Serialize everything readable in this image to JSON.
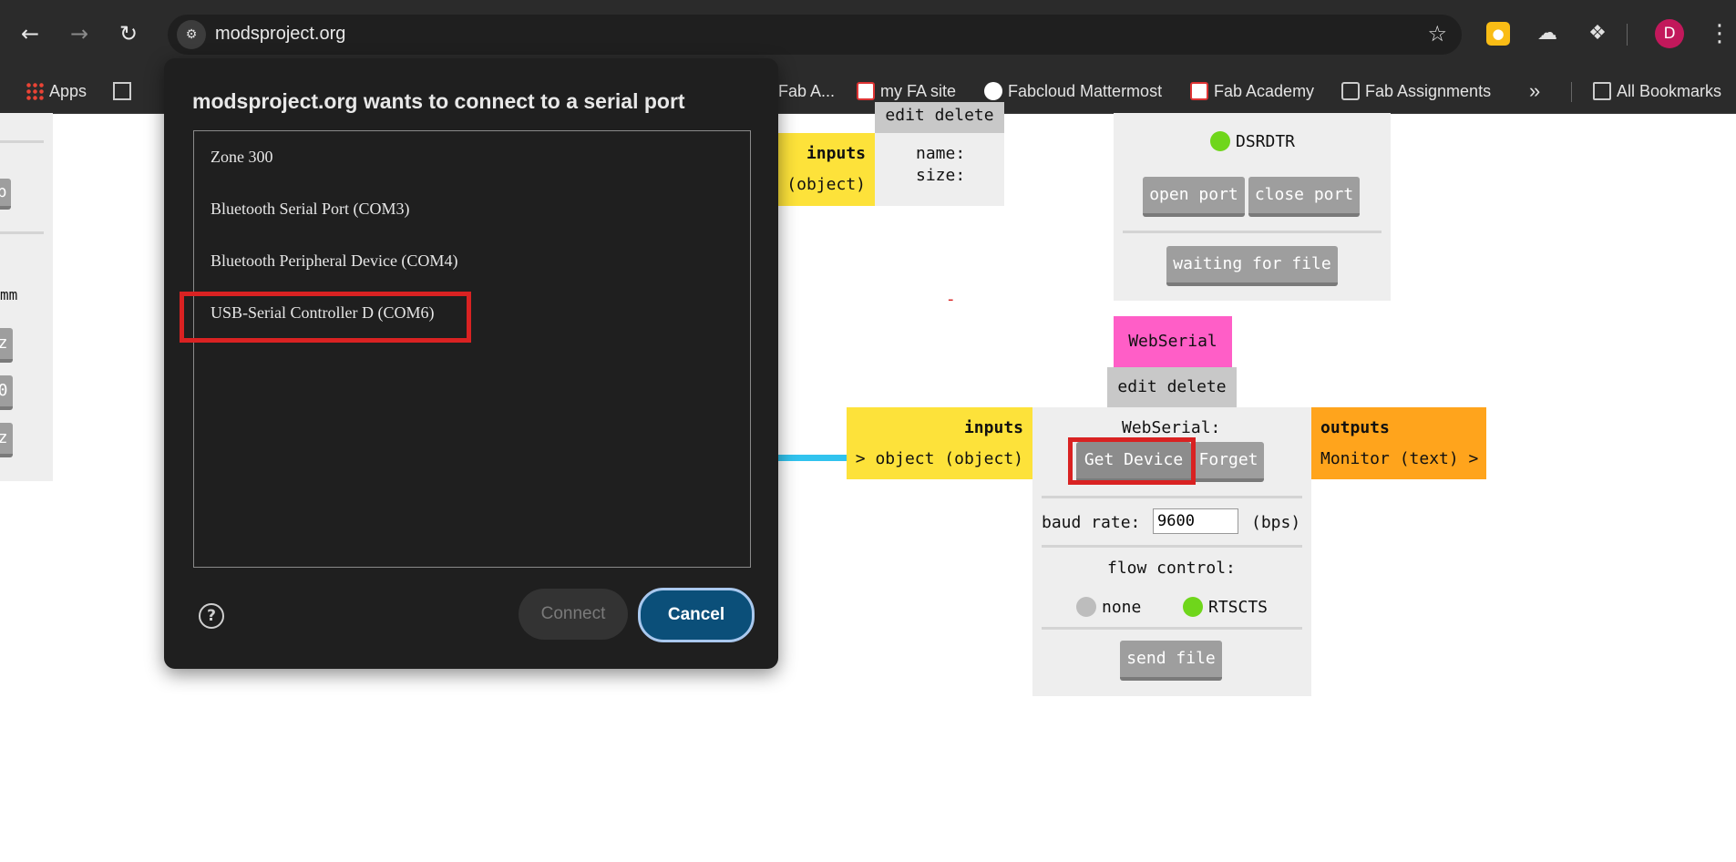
{
  "browser": {
    "url": "modsproject.org",
    "avatar_letter": "D",
    "bookmarks": [
      {
        "label": "Apps"
      },
      {
        "label": "Fab A..."
      },
      {
        "label": "my FA site"
      },
      {
        "label": "Fabcloud Mattermost"
      },
      {
        "label": "Fab Academy"
      },
      {
        "label": "Fab Assignments"
      }
    ],
    "all_bookmarks": "All Bookmarks",
    "overflow": "»"
  },
  "dialog": {
    "title": "modsproject.org wants to connect to a serial port",
    "ports": [
      "Zone 300",
      "Bluetooth Serial Port (COM3)",
      "Bluetooth Peripheral Device (COM4)",
      "USB-Serial Controller D (COM6)"
    ],
    "help": "?",
    "connect": "Connect",
    "cancel": "Cancel"
  },
  "mods": {
    "left_panel": {
      "text_mm": "mm",
      "btn_p": "p",
      "btn_z1": "z",
      "btn_0": "0",
      "btn_z2": "z"
    },
    "file_module": {
      "edit_delete": "edit delete",
      "inputs_label": "inputs",
      "inputs_type": "(object)",
      "name_label": "name:",
      "size_label": "size:"
    },
    "serial_module": {
      "dsrdtr": "DSRDTR",
      "open_port": "open port",
      "close_port": "close port",
      "waiting": "waiting for file"
    },
    "marker": "-",
    "webserial": {
      "title": "WebSerial",
      "edit_delete": "edit delete",
      "inputs_label": "inputs",
      "input_port": "> object (object)",
      "outputs_label": "outputs",
      "output_port": "Monitor (text) >",
      "heading": "WebSerial:",
      "get_device": "Get Device",
      "forget": "Forget",
      "baud_label": "baud rate:",
      "baud_value": "9600",
      "baud_unit": "(bps)",
      "flow_label": "flow control:",
      "flow_none": "none",
      "flow_rtscts": "RTSCTS",
      "send_file": "send file"
    }
  },
  "colors": {
    "inputs": "#fde23a",
    "outputs": "#ffa41c",
    "title_pink": "#ff5ec7",
    "wire": "#31c3ee",
    "active_dot": "#6fd61b",
    "inactive_dot": "#bdbdbd",
    "highlight": "#d92222"
  }
}
